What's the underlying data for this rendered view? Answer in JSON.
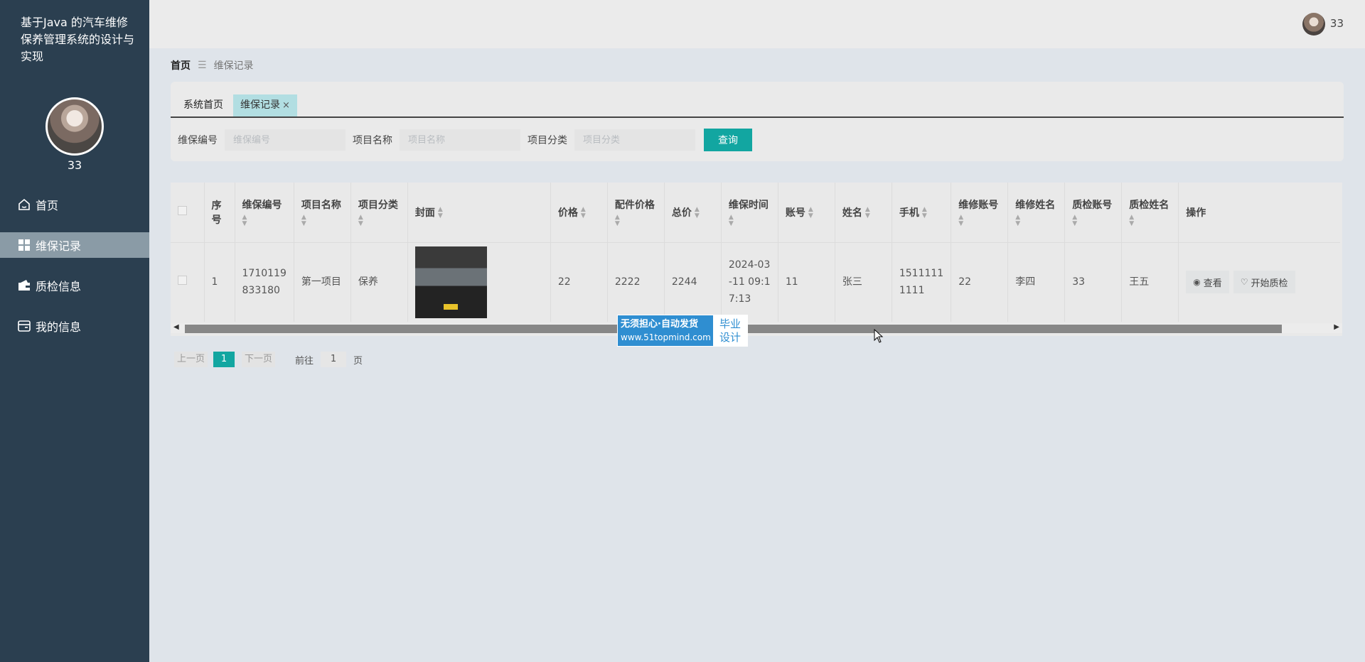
{
  "app": {
    "title": "基于Java 的汽车维修保养管理系统的设计与实现"
  },
  "sidebar": {
    "username": "33",
    "items": [
      {
        "label": "首页",
        "icon": "home-icon",
        "active": false
      },
      {
        "label": "维保记录",
        "icon": "grid-icon",
        "active": true
      },
      {
        "label": "质检信息",
        "icon": "wallet-icon",
        "active": false
      },
      {
        "label": "我的信息",
        "icon": "card-icon",
        "active": false
      }
    ]
  },
  "header": {
    "username": "33"
  },
  "breadcrumb": {
    "home": "首页",
    "current": "维保记录"
  },
  "tabs": [
    {
      "label": "系统首页"
    },
    {
      "label": "维保记录",
      "close": "×"
    }
  ],
  "search": {
    "fields": [
      {
        "label": "维保编号",
        "placeholder": "维保编号"
      },
      {
        "label": "项目名称",
        "placeholder": "项目名称"
      },
      {
        "label": "项目分类",
        "placeholder": "项目分类"
      }
    ],
    "button": "查询"
  },
  "table": {
    "headers": [
      "序号",
      "维保编号",
      "项目名称",
      "项目分类",
      "封面",
      "价格",
      "配件价格",
      "总价",
      "维保时间",
      "账号",
      "姓名",
      "手机",
      "维修账号",
      "维修姓名",
      "质检账号",
      "质检姓名",
      "操作"
    ],
    "rows": [
      {
        "index": "1",
        "code": "1710119833180",
        "code_l1": "1710119",
        "code_l2": "833180",
        "project": "第一项目",
        "category": "保养",
        "price": "22",
        "parts_price": "2222",
        "total": "2244",
        "time_l1": "2024-03",
        "time_l2": "-11 09:1",
        "time_l3": "7:13",
        "account": "11",
        "name": "张三",
        "phone_l1": "1511111",
        "phone_l2": "1111",
        "repair_account": "22",
        "repair_name": "李四",
        "qc_account": "33",
        "qc_name": "王五",
        "actions": {
          "view": "查看",
          "qc": "开始质检"
        }
      }
    ]
  },
  "pagination": {
    "prev": "上一页",
    "current": "1",
    "next": "下一页",
    "goto_prefix": "前往",
    "goto_value": "1",
    "goto_suffix": "页"
  },
  "watermark": {
    "line1": "无须担心·自动发货",
    "line2": "www.51topmind.com",
    "right1": "毕业",
    "right2": "设计"
  },
  "colors": {
    "sidebar": "#2b3f50",
    "accent": "#12a6a1",
    "active_nav": "#8a9ba6"
  }
}
